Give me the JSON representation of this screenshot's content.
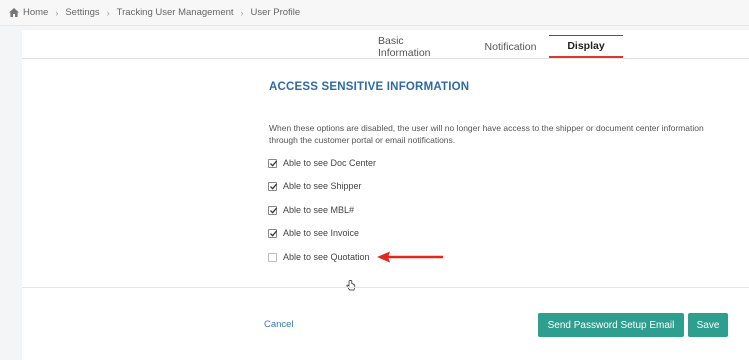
{
  "breadcrumb": {
    "items": [
      "Home",
      "Settings",
      "Tracking User Management",
      "User Profile"
    ]
  },
  "tabs": [
    {
      "label": "Basic Information",
      "active": false
    },
    {
      "label": "Notification",
      "active": false
    },
    {
      "label": "Display",
      "active": true
    }
  ],
  "section": {
    "title": "ACCESS SENSITIVE INFORMATION",
    "description": "When these options are disabled, the user will no longer have access to the shipper or document center information through the customer portal or email notifications."
  },
  "options": [
    {
      "label": "Able to see Doc Center",
      "checked": true
    },
    {
      "label": "Able to see Shipper",
      "checked": true
    },
    {
      "label": "Able to see MBL#",
      "checked": true
    },
    {
      "label": "Able to see Invoice",
      "checked": true
    },
    {
      "label": "Able to see Quotation",
      "checked": false
    }
  ],
  "footer": {
    "cancel_label": "Cancel",
    "setup_email_label": "Send Password Setup Email",
    "save_label": "Save"
  },
  "colors": {
    "accent_teal": "#2e9e8f",
    "title_blue": "#2f6aa3",
    "tab_underline_red": "#d63a2a",
    "annotation_arrow_red": "#e5281c"
  },
  "icons": {
    "home": "home-icon",
    "breadcrumb_separator": "chevron-right-icon",
    "annotation": "red-arrow-icon",
    "pointer": "hand-cursor-icon"
  }
}
